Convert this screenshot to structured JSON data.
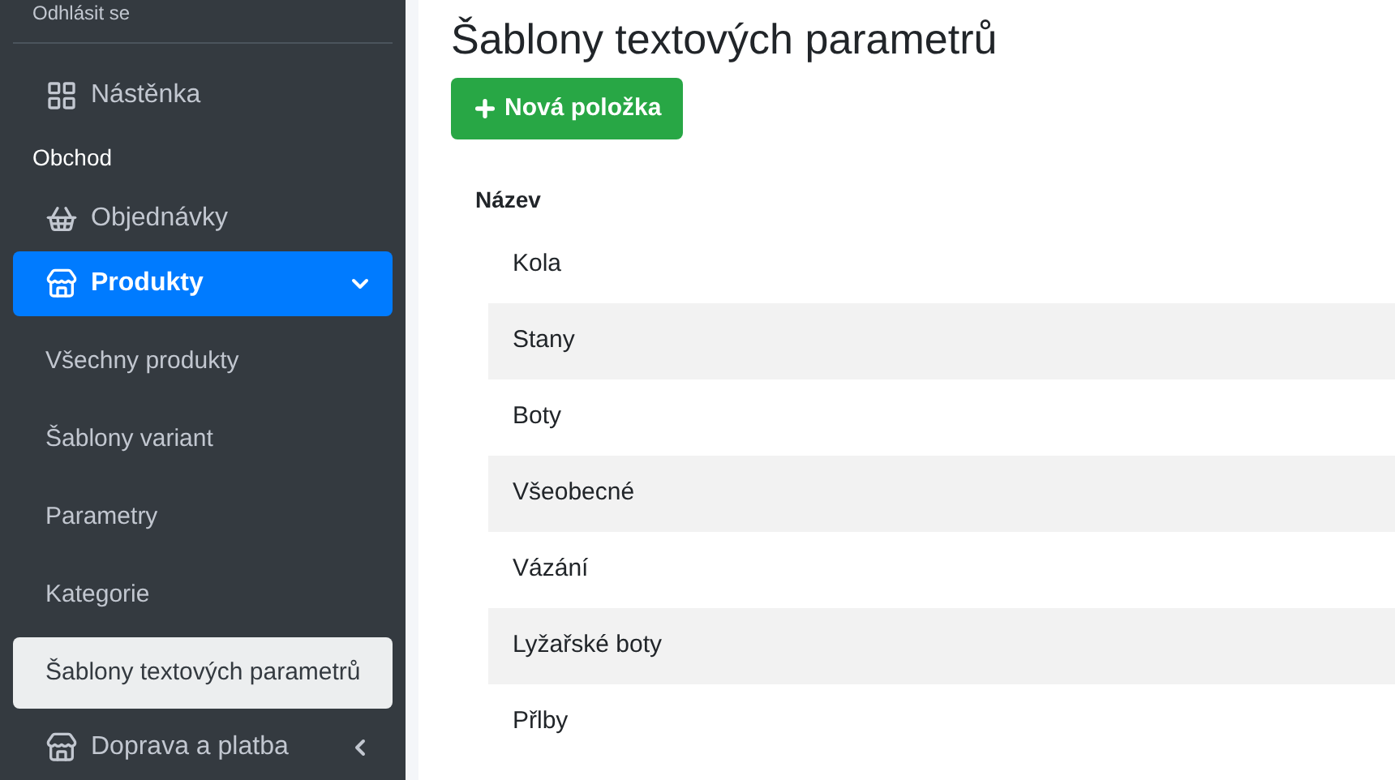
{
  "sidebar": {
    "logout": "Odhlásit se",
    "items": [
      {
        "kind": "item",
        "label": "Nástěnka",
        "selected": false
      },
      {
        "kind": "header",
        "label": "Obchod"
      },
      {
        "kind": "item",
        "label": "Objednávky",
        "selected": false
      },
      {
        "kind": "group",
        "label": "Produkty",
        "selected": true,
        "expanded": true,
        "children": [
          {
            "label": "Všechny produkty",
            "selected": false
          },
          {
            "label": "Šablony variant",
            "selected": false
          },
          {
            "label": "Parametry",
            "selected": false
          },
          {
            "label": "Kategorie",
            "selected": false
          },
          {
            "label": "Šablony textových parametrů",
            "selected": true
          }
        ]
      },
      {
        "kind": "group",
        "label": "Doprava a platba",
        "selected": false,
        "expanded": false
      }
    ]
  },
  "main": {
    "title": "Šablony textových parametrů",
    "new_button": "Nová položka",
    "table": {
      "columns": [
        "Název"
      ],
      "rows": [
        [
          "Kola"
        ],
        [
          "Stany"
        ],
        [
          "Boty"
        ],
        [
          "Všeobecné"
        ],
        [
          "Vázání"
        ],
        [
          "Lyžařské boty"
        ],
        [
          "Přlby"
        ]
      ]
    }
  }
}
